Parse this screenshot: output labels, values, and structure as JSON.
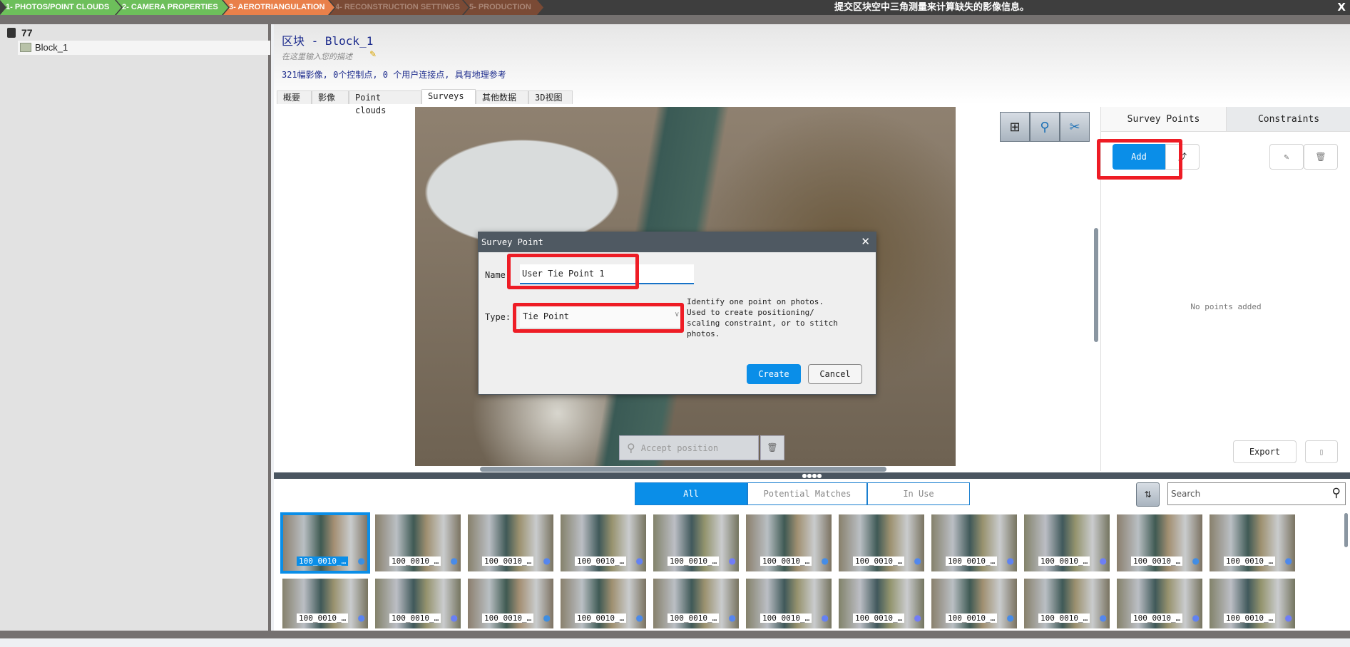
{
  "steps": [
    {
      "label": "1- PHOTOS/POINT CLOUDS",
      "bg": "#6dbf5b",
      "fg": "#ffffff"
    },
    {
      "label": "2- CAMERA PROPERTIES",
      "bg": "#6dbf5b",
      "fg": "#ffffff"
    },
    {
      "label": "3- AEROTRIANGULATION",
      "bg": "#e9804a",
      "fg": "#ffffff"
    },
    {
      "label": "4- RECONSTRUCTION SETTINGS",
      "bg": "#7a4a35",
      "fg": "#a98676"
    },
    {
      "label": "5- PRODUCTION",
      "bg": "#7a4a35",
      "fg": "#a98676"
    }
  ],
  "banner": {
    "text": "提交区块空中三角测量来计算缺失的影像信息。",
    "close": "X"
  },
  "tree": {
    "project": "77",
    "block": "Block_1"
  },
  "header": {
    "title": "区块 - Block_1",
    "description_placeholder": "在这里输入您的描述",
    "summary": "321幅影像, 0个控制点, 0 个用户连接点, 具有地理参考"
  },
  "tabs": [
    "概要",
    "影像",
    "Point clouds",
    "Surveys",
    "其他数据",
    "3D视图"
  ],
  "active_tab": "Surveys",
  "viewer": {
    "accept_label": "Accept position"
  },
  "right_panel": {
    "tabs": [
      "Survey Points",
      "Constraints"
    ],
    "add_label": "Add",
    "empty_text": "No points added",
    "export_label": "Export"
  },
  "filter": {
    "tabs": [
      "All",
      "Potential Matches",
      "In Use"
    ],
    "search_placeholder": "Search"
  },
  "thumbnails": [
    "100_0010_…",
    "100_0010_…",
    "100_0010_…",
    "100_0010_…",
    "100_0010_…",
    "100_0010_…",
    "100_0010_…",
    "100_0010_…",
    "100_0010_…",
    "100_0010_…",
    "100_0010_…",
    "100_0010_…",
    "100_0010_…",
    "100_0010_…",
    "100_0010_…",
    "100_0010_…",
    "100_0010_…",
    "100_0010_…",
    "100_0010_…",
    "100_0010_…",
    "100_0010_…",
    "100_0010_…"
  ],
  "dialog": {
    "title": "Survey Point",
    "name_label": "Name",
    "name_value": "User Tie Point 1",
    "type_label": "Type:",
    "type_value": "Tie Point",
    "help": "Identify one point on photos. Used to create positioning/ scaling constraint, or to stitch photos.",
    "create_label": "Create",
    "cancel_label": "Cancel",
    "close": "✕"
  },
  "colors": {
    "accent": "#0a8ee8",
    "highlight": "#ee1c25"
  }
}
